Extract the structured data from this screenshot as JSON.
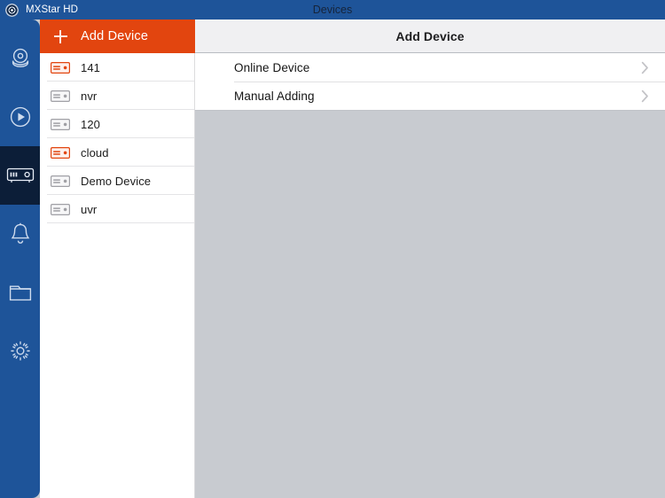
{
  "window": {
    "app_name": "MXStar HD",
    "title": "Devices",
    "app_icon": "app-logo-icon",
    "colors": {
      "titlebar_blue": "#1e5499",
      "accent_orange": "#e2450f",
      "rail_active": "#0c1e38",
      "detail_bg": "#c8cbd0",
      "device_online": "#e2450f",
      "device_offline": "#9a9a9e"
    }
  },
  "sidebar": {
    "items": [
      {
        "icon": "live-view-camera-icon",
        "active": false
      },
      {
        "icon": "playback-play-circle-icon",
        "active": false
      },
      {
        "icon": "device-manager-icon",
        "active": true
      },
      {
        "icon": "alarm-bell-icon",
        "active": false
      },
      {
        "icon": "folder-icon",
        "active": false
      },
      {
        "icon": "settings-gear-icon",
        "active": false
      }
    ]
  },
  "device_panel": {
    "header": {
      "label": "Add Device",
      "plus_icon": "plus-icon"
    },
    "devices": [
      {
        "name": "141",
        "status": "online",
        "icon": "nvr-device-icon"
      },
      {
        "name": "nvr",
        "status": "offline",
        "icon": "nvr-device-icon"
      },
      {
        "name": "120",
        "status": "offline",
        "icon": "nvr-device-icon"
      },
      {
        "name": "cloud",
        "status": "online",
        "icon": "nvr-device-icon"
      },
      {
        "name": "Demo Device",
        "status": "offline",
        "icon": "nvr-device-icon"
      },
      {
        "name": "uvr",
        "status": "offline",
        "icon": "nvr-device-icon"
      }
    ]
  },
  "detail_panel": {
    "title": "Add Device",
    "rows": [
      {
        "label": "Online Device",
        "chevron": "chevron-right-icon"
      },
      {
        "label": "Manual Adding",
        "chevron": "chevron-right-icon"
      }
    ]
  }
}
